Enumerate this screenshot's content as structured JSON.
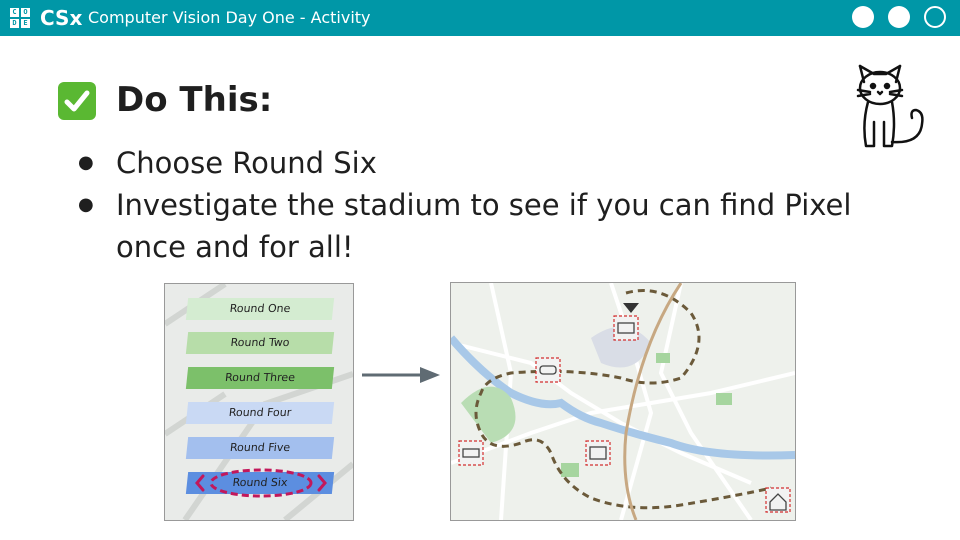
{
  "header": {
    "logo_letters": [
      "C",
      "O",
      "D",
      "E"
    ],
    "brand": "CSx",
    "title": "Computer Vision Day One - Activity",
    "bg_color": "#0097a7"
  },
  "content": {
    "heading": "Do This:",
    "bullets": [
      "Choose Round Six",
      "Investigate the stadium to see if you can find Pixel once and for all!"
    ]
  },
  "round_menu": {
    "items": [
      {
        "label": "Round One",
        "color": "#d4ecd1"
      },
      {
        "label": "Round Two",
        "color": "#b7dda9"
      },
      {
        "label": "Round Three",
        "color": "#7cc06a"
      },
      {
        "label": "Round Four",
        "color": "#c9d9f4"
      },
      {
        "label": "Round Five",
        "color": "#a3bfee"
      },
      {
        "label": "Round Six",
        "color": "#5c8ee0"
      }
    ],
    "highlight_color": "#c2185b"
  },
  "icons": {
    "check": "check-mark-icon",
    "cat": "cat-icon",
    "arrow": "right-arrow-icon"
  }
}
